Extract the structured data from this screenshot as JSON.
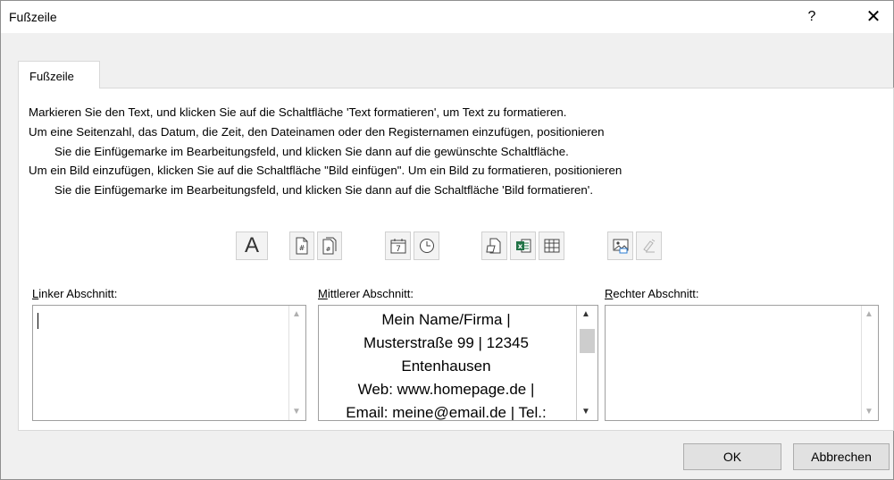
{
  "dialog": {
    "title": "Fußzeile",
    "help_label": "?",
    "close_label": "✕"
  },
  "tab": {
    "label": "Fußzeile"
  },
  "instructions": {
    "line1": "Markieren Sie den Text, und klicken Sie auf die Schaltfläche 'Text formatieren', um Text zu formatieren.",
    "line2": "Um eine Seitenzahl, das Datum, die Zeit, den Dateinamen oder den Registernamen einzufügen, positionieren",
    "line3": "Sie die Einfügemarke im Bearbeitungsfeld, und klicken Sie dann auf die gewünschte Schaltfläche.",
    "line4": "Um ein Bild einzufügen, klicken Sie auf die Schaltfläche \"Bild einfügen\". Um ein Bild zu formatieren, positionieren",
    "line5": "Sie die Einfügemarke im Bearbeitungsfeld, und klicken Sie dann auf die Schaltfläche 'Bild formatieren'."
  },
  "toolbar": {
    "icons": [
      "format-text-icon",
      "page-number-icon",
      "page-count-icon",
      "date-icon",
      "time-icon",
      "file-path-icon",
      "file-name-icon",
      "sheet-name-icon",
      "insert-picture-icon",
      "format-picture-icon"
    ],
    "format_text_glyph": "A"
  },
  "sections": {
    "left": {
      "label_accel": "L",
      "label_rest": "inker Abschnitt:",
      "content": ""
    },
    "center": {
      "label_accel": "M",
      "label_rest": "ittlerer Abschnitt:",
      "lines": [
        "Mein Name/Firma |",
        "Musterstraße 99 | 12345",
        "Entenhausen",
        "Web: www.homepage.de |",
        "Email: meine@email.de | Tel.:"
      ]
    },
    "right": {
      "label_accel": "R",
      "label_rest": "echter Abschnitt:",
      "content": ""
    }
  },
  "buttons": {
    "ok": "OK",
    "cancel": "Abbrechen"
  }
}
